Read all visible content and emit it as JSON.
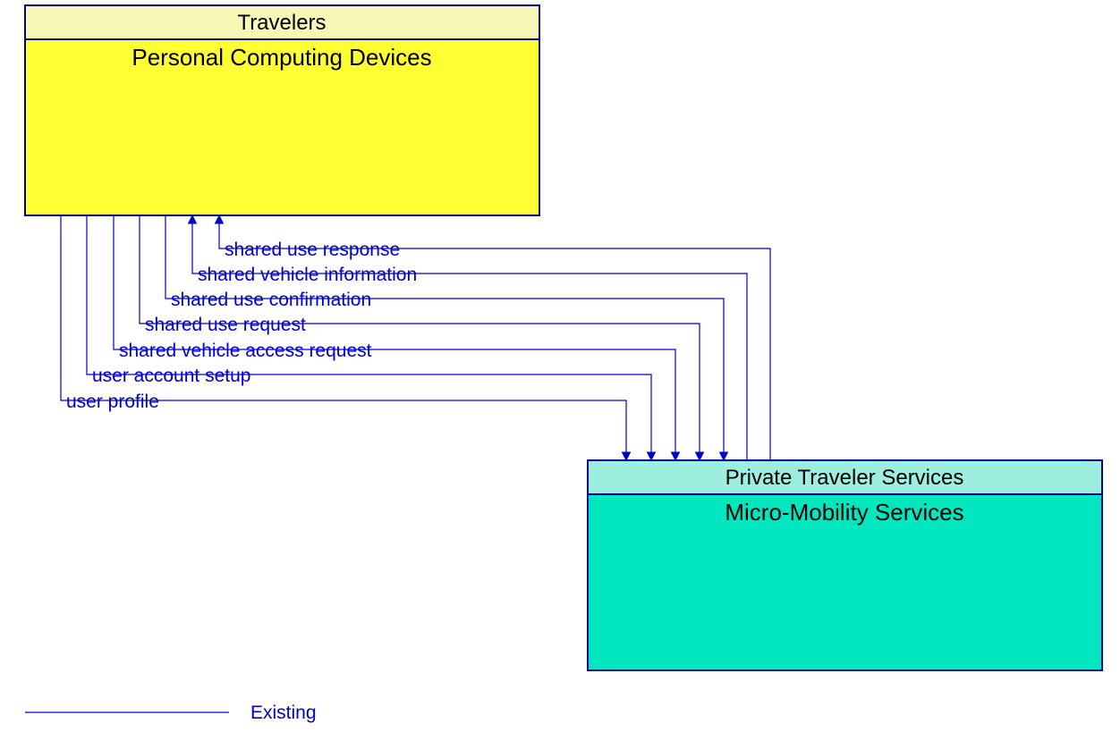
{
  "boxA": {
    "header": "Travelers",
    "body": "Personal Computing Devices"
  },
  "boxB": {
    "header": "Private Traveler Services",
    "body": "Micro-Mobility Services"
  },
  "flows": {
    "f0": "shared use response",
    "f1": "shared vehicle information",
    "f2": "shared use confirmation",
    "f3": "shared use request",
    "f4": "shared vehicle access request",
    "f5": "user account setup",
    "f6": "user profile"
  },
  "legend": {
    "existing": "Existing"
  },
  "colors": {
    "headerA": "#F7F7B6",
    "bodyA": "#FFFF33",
    "headerB": "#9EEEDF",
    "bodyB": "#00E6BE",
    "stroke": "#00008B",
    "line": "#0000CD"
  }
}
